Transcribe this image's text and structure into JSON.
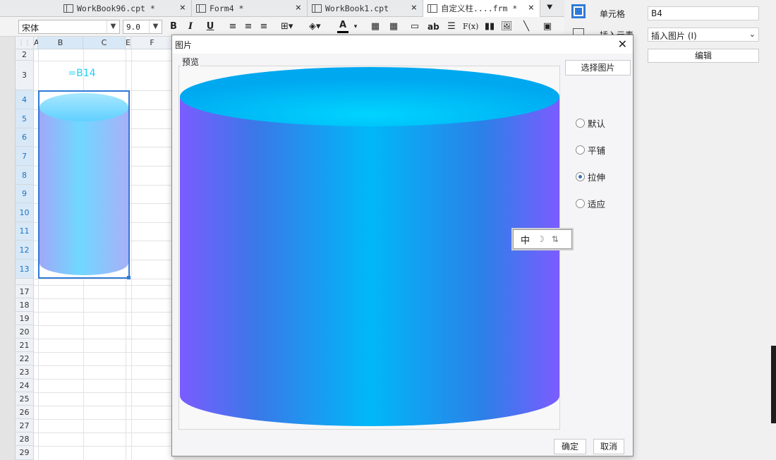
{
  "tabs": [
    {
      "label": "WorkBook96.cpt *",
      "active": false
    },
    {
      "label": "Form4 *",
      "active": false
    },
    {
      "label": "WorkBook1.cpt",
      "active": false
    },
    {
      "label": "自定义柱....frm *",
      "active": true
    }
  ],
  "toolbar": {
    "font_name": "宋体",
    "font_size": "9.0",
    "bold": "B",
    "italic": "I",
    "underline": "U",
    "text_tool": "ab",
    "formula_tool": "F(x)"
  },
  "sheet": {
    "columns": [
      "A",
      "B",
      "C",
      "E",
      "F"
    ],
    "rows": [
      "2",
      "3",
      "4",
      "5",
      "6",
      "7",
      "8",
      "9",
      "10",
      "11",
      "12",
      "13",
      "17",
      "18",
      "19",
      "20",
      "21",
      "22",
      "23",
      "24",
      "25",
      "26",
      "27",
      "28",
      "29"
    ],
    "cell_B3_formula": "=B14",
    "selected_cell": "B4"
  },
  "right_panel": {
    "cell_label": "单元格",
    "cell_value": "B4",
    "insert_label": "插入元素",
    "insert_value": "插入图片 (I)",
    "edit_button": "编辑"
  },
  "dialog": {
    "title": "图片",
    "preview_label": "预览",
    "select_button": "选择图片",
    "options": [
      {
        "label": "默认",
        "checked": false
      },
      {
        "label": "平铺",
        "checked": false
      },
      {
        "label": "拉伸",
        "checked": true
      },
      {
        "label": "适应",
        "checked": false
      }
    ],
    "ok_button": "确定",
    "cancel_button": "取消"
  },
  "ime": {
    "text": "中"
  },
  "colors": {
    "accent": "#1a73c8",
    "cylinder_top": "#00c8f8",
    "cylinder_side_edge": "#7b5cff",
    "selection": "#2f7ad8"
  }
}
